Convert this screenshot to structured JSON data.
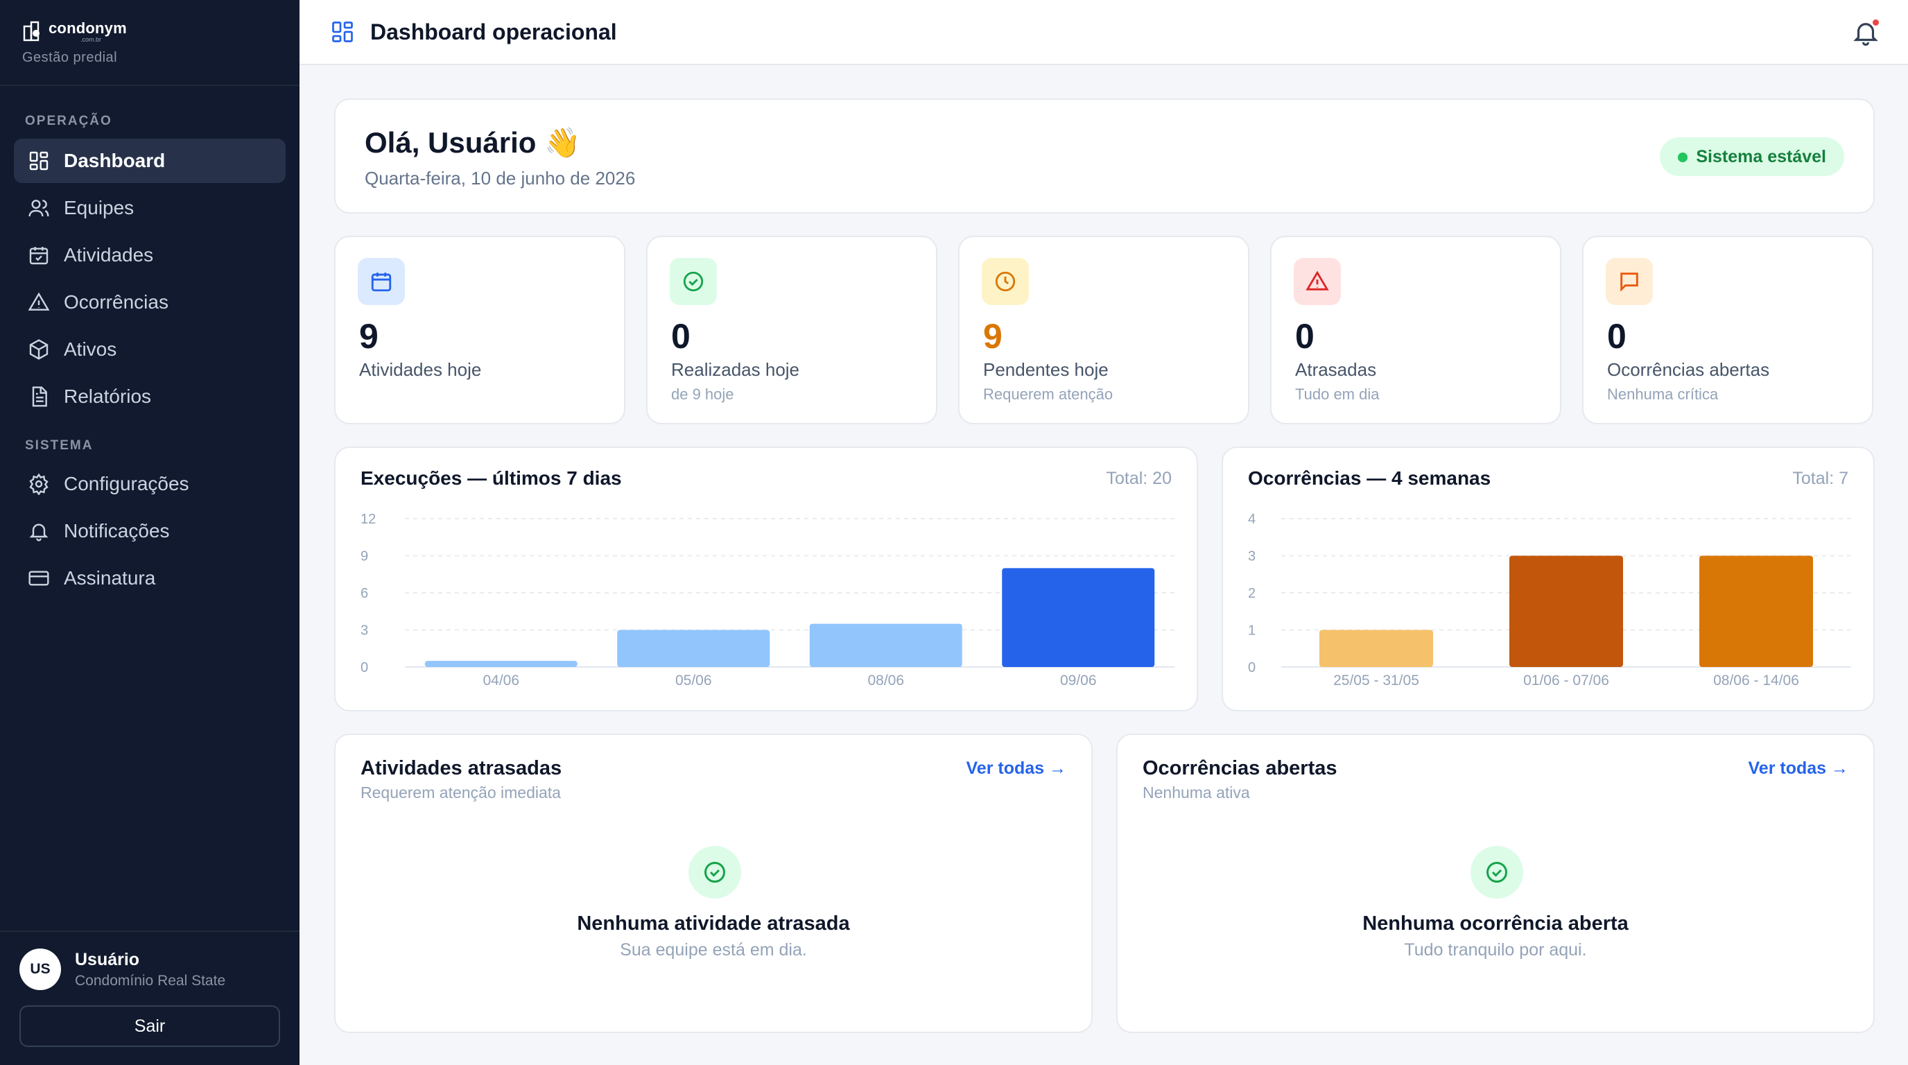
{
  "brand": {
    "logo_text": "condonym",
    "logo_sub": ".com.br",
    "subtitle": "Gestão predial"
  },
  "sidebar": {
    "section_operation": "OPERAÇÃO",
    "section_system": "SISTEMA",
    "items": [
      {
        "label": "Dashboard",
        "icon": "dashboard-icon",
        "active": true
      },
      {
        "label": "Equipes",
        "icon": "users-icon"
      },
      {
        "label": "Atividades",
        "icon": "calendar-check-icon"
      },
      {
        "label": "Ocorrências",
        "icon": "warning-icon"
      },
      {
        "label": "Ativos",
        "icon": "box-icon"
      },
      {
        "label": "Relatórios",
        "icon": "file-text-icon"
      }
    ],
    "system_items": [
      {
        "label": "Configurações",
        "icon": "gear-icon"
      },
      {
        "label": "Notificações",
        "icon": "bell-icon"
      },
      {
        "label": "Assinatura",
        "icon": "credit-card-icon"
      }
    ],
    "user": {
      "initials": "US",
      "name": "Usuário",
      "org": "Condomínio Real State"
    },
    "logout_label": "Sair"
  },
  "header": {
    "title": "Dashboard operacional"
  },
  "hero": {
    "greeting": "Olá, Usuário 👋",
    "date": "Quarta-feira, 10 de junho de 2026",
    "status": "Sistema estável"
  },
  "stats": [
    {
      "value": "9",
      "label": "Atividades hoje",
      "sub": "",
      "color": "#0f172a",
      "icon_bg": "#dbeafe",
      "icon_color": "#2563eb"
    },
    {
      "value": "0",
      "label": "Realizadas hoje",
      "sub": "de 9 hoje",
      "color": "#0f172a",
      "icon_bg": "#dcfce7",
      "icon_color": "#16a34a"
    },
    {
      "value": "9",
      "label": "Pendentes hoje",
      "sub": "Requerem atenção",
      "color": "#d97706",
      "icon_bg": "#fef3c7",
      "icon_color": "#d97706"
    },
    {
      "value": "0",
      "label": "Atrasadas",
      "sub": "Tudo em dia",
      "color": "#0f172a",
      "icon_bg": "#fee2e2",
      "icon_color": "#dc2626"
    },
    {
      "value": "0",
      "label": "Ocorrências abertas",
      "sub": "Nenhuma crítica",
      "color": "#0f172a",
      "icon_bg": "#ffedd5",
      "icon_color": "#ea580c"
    }
  ],
  "charts": {
    "executions": {
      "title": "Execuções — últimos 7 dias",
      "total": "Total: 20"
    },
    "occurrences": {
      "title": "Ocorrências — 4 semanas",
      "total": "Total: 7"
    }
  },
  "chart_data": [
    {
      "type": "bar",
      "title": "Execuções — últimos 7 dias",
      "categories": [
        "04/06",
        "05/06",
        "08/06",
        "09/06"
      ],
      "values": [
        0.5,
        3,
        3.5,
        8
      ],
      "colors": [
        "#93c5fd",
        "#93c5fd",
        "#93c5fd",
        "#2563eb"
      ],
      "yticks": [
        0,
        3,
        6,
        9,
        12
      ],
      "ylim": [
        0,
        12
      ],
      "grid": true
    },
    {
      "type": "bar",
      "title": "Ocorrências — 4 semanas",
      "categories": [
        "25/05 - 31/05",
        "01/06 - 07/06",
        "08/06 - 14/06"
      ],
      "values": [
        1,
        3,
        3
      ],
      "colors": [
        "#f5c26b",
        "#c2570c",
        "#d97706"
      ],
      "yticks": [
        0,
        1,
        2,
        3,
        4
      ],
      "ylim": [
        0,
        4
      ],
      "grid": true
    }
  ],
  "late": {
    "title": "Atividades atrasadas",
    "sub": "Requerem atenção imediata",
    "link": "Ver todas →",
    "empty_title": "Nenhuma atividade atrasada",
    "empty_sub": "Sua equipe está em dia."
  },
  "open_occ": {
    "title": "Ocorrências abertas",
    "sub": "Nenhuma ativa",
    "link": "Ver todas →",
    "empty_title": "Nenhuma ocorrência aberta",
    "empty_sub": "Tudo tranquilo por aqui."
  }
}
